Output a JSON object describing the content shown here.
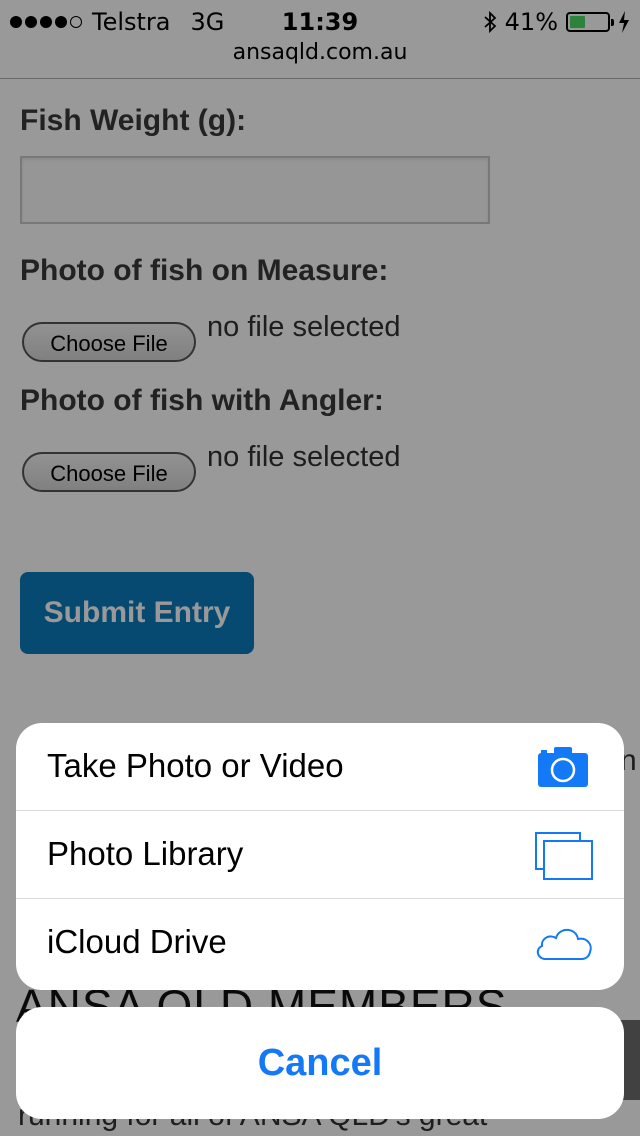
{
  "status_bar": {
    "carrier": "Telstra",
    "network": "3G",
    "time": "11:39",
    "battery_percent": "41%",
    "battery_level": 0.41,
    "signal_bars": 4
  },
  "browser": {
    "url": "ansaqld.com.au"
  },
  "form": {
    "weight_label": "Fish Weight (g):",
    "weight_value": "",
    "measure_photo_label": "Photo of fish on Measure:",
    "angler_photo_label": "Photo of fish with Angler:",
    "choose_file_label": "Choose File",
    "no_file_text": "no file selected",
    "submit_label": "Submit Entry"
  },
  "background": {
    "heading": "ANSA QLD MEMBERS",
    "text": "running for all of ANSA QLD's great",
    "edge_text": "n"
  },
  "action_sheet": {
    "items": [
      {
        "label": "Take Photo or Video",
        "icon": "camera-icon"
      },
      {
        "label": "Photo Library",
        "icon": "photo-library-icon"
      },
      {
        "label": "iCloud Drive",
        "icon": "cloud-icon"
      }
    ],
    "cancel_label": "Cancel"
  },
  "colors": {
    "accent": "#1479f6",
    "submit": "#0a7cbf",
    "battery": "#4cd964"
  }
}
